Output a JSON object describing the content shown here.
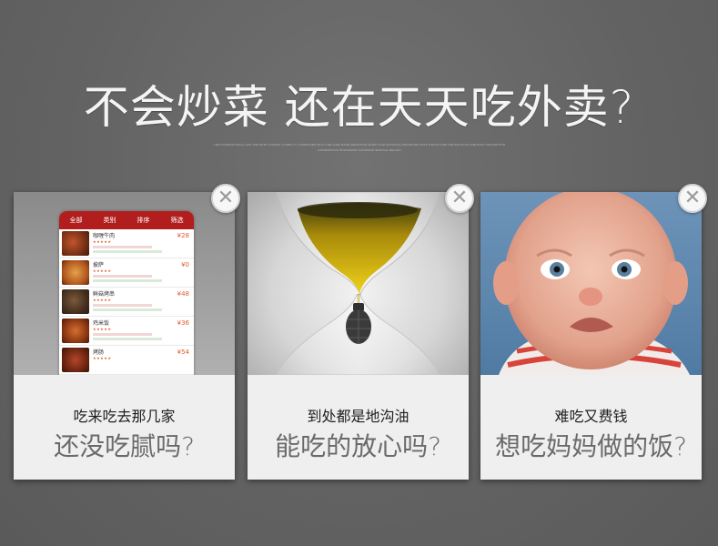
{
  "headline": "不会炒菜 还在天天吃外卖?",
  "fine_print": [
    "THE INTERNATIONAL GAS INDUSTRY FORMAL STABILITY COMPANIES WITH THE CHEF BASE ADDICTION ADOPT AND RATIONAL PROGRAMS WITH STRUCTURE PROTECTION CAMPAIGN ASSUMPTION",
    "INFORMATION PROGRAMS STANDARD SERVICE REGION"
  ],
  "cards": [
    {
      "line1": "吃来吃去那几家",
      "line2": "还没吃腻吗?",
      "image": "food-delivery-app-photo"
    },
    {
      "line1": "到处都是地沟油",
      "line2": "能吃的放心吗?",
      "image": "hourglass-oil-grenade-photo"
    },
    {
      "line1": "难吃又费钱",
      "line2": "想吃妈妈做的饭?",
      "image": "crying-baby-photo"
    }
  ],
  "close_glyph": "✕",
  "app": {
    "tabs": [
      "全部",
      "类别",
      "排序",
      "筛选"
    ],
    "items": [
      {
        "name": "咖喱牛肉",
        "price": "¥28",
        "stars": "★★★★★"
      },
      {
        "name": "披萨",
        "price": "¥0",
        "stars": "★★★★★"
      },
      {
        "name": "鲜菇烤串",
        "price": "¥48",
        "stars": "★★★★★"
      },
      {
        "name": "鸡米饭",
        "price": "¥36",
        "stars": "★★★★★"
      },
      {
        "name": "烤肠",
        "price": "¥54",
        "stars": "★★★★★"
      }
    ]
  },
  "colors": {
    "background": "#666666",
    "card": "#efefef",
    "app_red": "#b21d1d",
    "caption_gray": "#6a6a6a"
  }
}
